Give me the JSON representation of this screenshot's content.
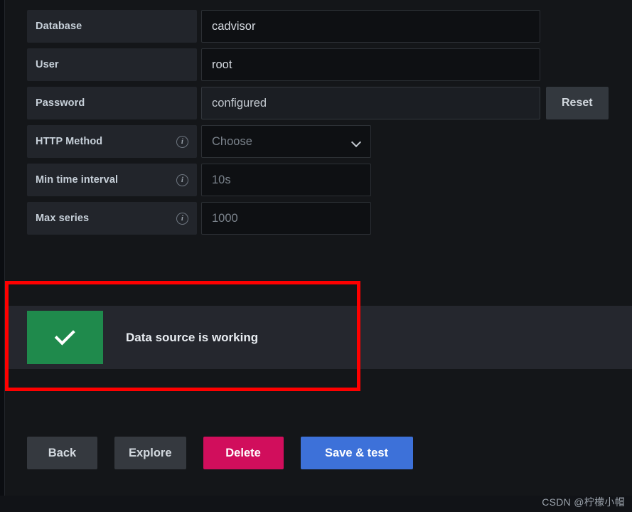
{
  "form": {
    "rows": [
      {
        "label": "Database",
        "info": false,
        "value": "cadvisor",
        "state": "value",
        "width": "wide",
        "type": "text"
      },
      {
        "label": "User",
        "info": false,
        "value": "root",
        "state": "value",
        "width": "wide",
        "type": "text"
      },
      {
        "label": "Password",
        "info": false,
        "value": "configured",
        "state": "disabled",
        "width": "wide",
        "type": "text",
        "action": "Reset"
      },
      {
        "label": "HTTP Method",
        "info": true,
        "value": "Choose",
        "state": "placeholder",
        "width": "medium",
        "type": "select"
      },
      {
        "label": "Min time interval",
        "info": true,
        "value": "10s",
        "state": "placeholder",
        "width": "medium",
        "type": "text"
      },
      {
        "label": "Max series",
        "info": true,
        "value": "1000",
        "state": "placeholder",
        "width": "medium",
        "type": "text"
      }
    ],
    "info_glyph": "i",
    "reset_label": "Reset"
  },
  "alert": {
    "message": "Data source is working",
    "icon": "check-icon",
    "icon_color": "#1f8a4c",
    "panel_color": "#25272e"
  },
  "annotation": {
    "color": "#fe0000"
  },
  "buttons": [
    {
      "label": "Back",
      "style": "secondary"
    },
    {
      "label": "Explore",
      "style": "secondary"
    },
    {
      "label": "Delete",
      "style": "danger"
    },
    {
      "label": "Save & test",
      "style": "primary"
    }
  ],
  "watermark": "CSDN @柠檬小帽"
}
